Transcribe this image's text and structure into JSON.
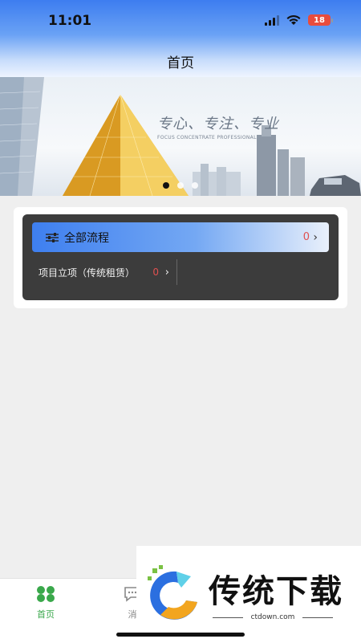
{
  "status_bar": {
    "time": "11:01",
    "battery": "18"
  },
  "header": {
    "title": "首页"
  },
  "banner": {
    "slogan": "专心、专注、专业",
    "slogan_sub": "FOCUS CONCENTRATE PROFESSIONAL",
    "slides": 3,
    "active_slide": 1
  },
  "workflow": {
    "all": {
      "label": "全部流程",
      "count": "0",
      "icon": "filter-icon"
    },
    "items": [
      {
        "label": "项目立项（传统租赁）",
        "count": "0"
      }
    ]
  },
  "tabbar": {
    "tabs": [
      {
        "label": "首页",
        "icon": "home-grid-icon",
        "active": true
      },
      {
        "label": "消",
        "icon": "message-icon",
        "active": false
      }
    ]
  },
  "watermark": {
    "title": "传统下载",
    "site": "ctdown.com"
  },
  "colors": {
    "accent": "#3e7ff0",
    "count_red": "#e05050",
    "tab_active": "#3aa84b"
  }
}
